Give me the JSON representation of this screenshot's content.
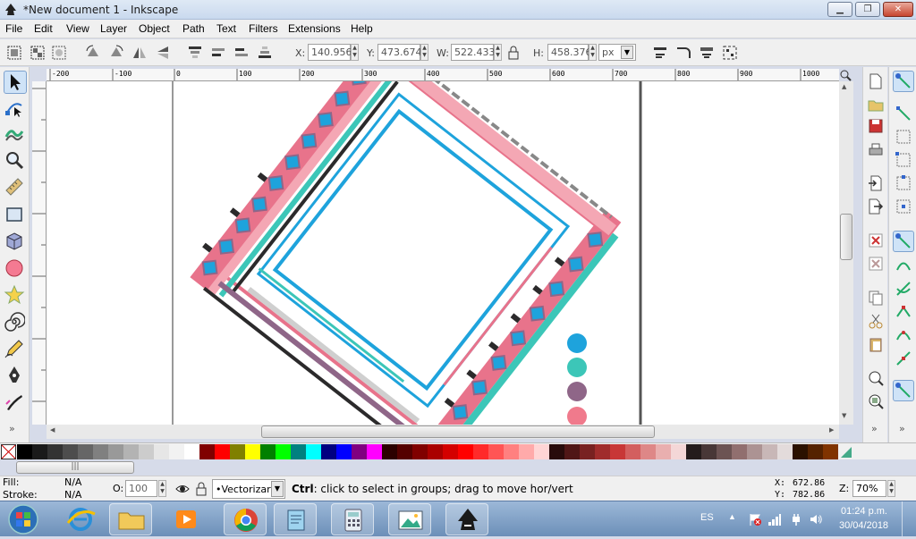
{
  "window": {
    "title": "*New document 1 - Inkscape",
    "minimize_glyph": "▁",
    "maximize_glyph": "❐",
    "close_glyph": "✕"
  },
  "menu": [
    "File",
    "Edit",
    "View",
    "Layer",
    "Object",
    "Path",
    "Text",
    "Filters",
    "Extensions",
    "Help"
  ],
  "toolbar": {
    "x_label": "X:",
    "x_value": "140.956",
    "y_label": "Y:",
    "y_value": "473.674",
    "w_label": "W:",
    "w_value": "522.433",
    "h_label": "H:",
    "h_value": "458.376",
    "unit": "px"
  },
  "ruler": {
    "top_ticks": [
      "-200",
      "-100",
      "0",
      "100",
      "200",
      "300",
      "400",
      "500",
      "600",
      "700",
      "800",
      "900",
      "1000"
    ]
  },
  "canvas": {
    "circle_colors": [
      "#1ea3dc",
      "#3cc6b8",
      "#8f6688",
      "#f07a8c"
    ],
    "colors": {
      "blue": "#1ea3dc",
      "teal": "#3cc6b8",
      "pink": "#e8738b",
      "light_pink": "#f4a7b4",
      "purple": "#8f6688",
      "dark": "#2b2a2b",
      "grey": "#cfcfcf"
    }
  },
  "palette": {
    "colors": [
      "#000000",
      "#1a1a1a",
      "#333333",
      "#4d4d4d",
      "#666666",
      "#808080",
      "#999999",
      "#b3b3b3",
      "#cccccc",
      "#e6e6e6",
      "#f2f2f2",
      "#ffffff",
      "#800000",
      "#ff0000",
      "#808000",
      "#ffff00",
      "#008000",
      "#00ff00",
      "#008080",
      "#00ffff",
      "#000080",
      "#0000ff",
      "#800080",
      "#ff00ff",
      "#2b0000",
      "#550000",
      "#800000",
      "#aa0000",
      "#d40000",
      "#ff0000",
      "#ff2a2a",
      "#ff5555",
      "#ff8080",
      "#ffaaaa",
      "#ffd5d5",
      "#280b0b",
      "#501616",
      "#782121",
      "#a02c2c",
      "#c83737",
      "#d35f5f",
      "#de8787",
      "#e9afaf",
      "#f4d7d7",
      "#241c1c",
      "#483737",
      "#6c5353",
      "#916f6f",
      "#ac9393",
      "#c8b7b7",
      "#e3dbdb",
      "#2b1100",
      "#552200",
      "#803300",
      "#aa4400",
      "#d45500"
    ]
  },
  "status": {
    "fill_label": "Fill:",
    "fill_value": "N/A",
    "stroke_label": "Stroke:",
    "stroke_value": "N/A",
    "opacity_label": "O:",
    "opacity_value": "100",
    "layer_name": "•Vectorizar",
    "hint_bold": "Ctrl",
    "hint_text": ": click to select in groups; drag to move hor/vert",
    "x_label": "X:",
    "x_value": "672.86",
    "y_label": "Y:",
    "y_value": "782.86",
    "zoom_label": "Z:",
    "zoom_value": "70%"
  },
  "taskbar": {
    "language": "ES",
    "time": "01:24 p.m.",
    "date": "30/04/2018"
  }
}
